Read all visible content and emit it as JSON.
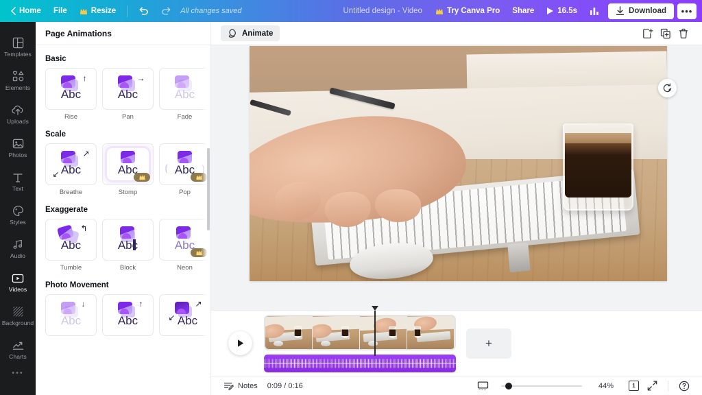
{
  "topbar": {
    "back_label": "",
    "home": "Home",
    "file": "File",
    "resize": "Resize",
    "undo_icon": "undo-icon",
    "redo_icon": "redo-icon",
    "save_status": "All changes saved",
    "design_title": "Untitled design - Video",
    "try_pro": "Try Canva Pro",
    "share": "Share",
    "duration": "16.5s",
    "insights_icon": "bar-chart-icon",
    "download": "Download",
    "more": "•••"
  },
  "sidebar": {
    "items": [
      {
        "label": "Templates",
        "icon": "templates-icon",
        "active": false
      },
      {
        "label": "Elements",
        "icon": "elements-icon",
        "active": false
      },
      {
        "label": "Uploads",
        "icon": "uploads-icon",
        "active": false
      },
      {
        "label": "Photos",
        "icon": "photos-icon",
        "active": false
      },
      {
        "label": "Text",
        "icon": "text-icon",
        "active": false
      },
      {
        "label": "Styles",
        "icon": "styles-icon",
        "active": false
      },
      {
        "label": "Audio",
        "icon": "audio-icon",
        "active": false
      },
      {
        "label": "Videos",
        "icon": "videos-icon",
        "active": true
      },
      {
        "label": "Background",
        "icon": "background-icon",
        "active": false
      },
      {
        "label": "Charts",
        "icon": "charts-icon",
        "active": false
      }
    ],
    "more": "•••"
  },
  "panel": {
    "title": "Page Animations",
    "sections": [
      {
        "title": "Basic",
        "items": [
          {
            "label": "Rise",
            "arrow": "↑",
            "pro": false,
            "faded": false
          },
          {
            "label": "Pan",
            "arrow": "→",
            "pro": false,
            "faded": false
          },
          {
            "label": "Fade",
            "arrow": "",
            "pro": false,
            "faded": true
          },
          {
            "label": "",
            "arrow": "",
            "pro": false,
            "faded": false
          }
        ]
      },
      {
        "title": "Scale",
        "items": [
          {
            "label": "Breathe",
            "arrow": "↗",
            "arrow2": "↙",
            "pro": false,
            "faded": false
          },
          {
            "label": "Stomp",
            "arrow": "",
            "pro": true,
            "faded": false,
            "halo": true
          },
          {
            "label": "Pop",
            "arrow": "",
            "pro": true,
            "faded": false
          },
          {
            "label": "",
            "arrow": "",
            "pro": false,
            "faded": false
          }
        ]
      },
      {
        "title": "Exaggerate",
        "items": [
          {
            "label": "Tumble",
            "arrow": "↰",
            "pro": false,
            "faded": false
          },
          {
            "label": "Block",
            "arrow": "",
            "pro": false,
            "faded": false
          },
          {
            "label": "Neon",
            "arrow": "",
            "pro": true,
            "faded": false
          },
          {
            "label": "",
            "arrow": "",
            "pro": false,
            "faded": false
          }
        ]
      },
      {
        "title": "Photo Movement",
        "items": [
          {
            "label": "",
            "arrow": "↓",
            "pro": false,
            "faded": true
          },
          {
            "label": "",
            "arrow": "↑",
            "pro": false,
            "faded": false
          },
          {
            "label": "",
            "arrow": "↗",
            "arrow2": "↙",
            "pro": false,
            "faded": false
          },
          {
            "label": "",
            "arrow": "",
            "pro": false,
            "faded": false
          }
        ]
      }
    ]
  },
  "editbar": {
    "animate_label": "Animate",
    "animate_icon": "animate-icon",
    "add_page_icon": "add-page-icon",
    "duplicate_page_icon": "duplicate-page-icon",
    "delete_page_icon": "trash-icon"
  },
  "canvas": {
    "magic_icon": "magic-refresh-icon",
    "description": "Photo of hands typing on a keyboard beside a glass of espresso on a wooden desk"
  },
  "timeline": {
    "play_icon": "play-icon",
    "add_page_label": "+",
    "video_track_name": "video-clip",
    "audio_track_name": "audio-clip"
  },
  "bottombar": {
    "notes_icon": "notes-icon",
    "notes": "Notes",
    "time": "0:09 / 0:16",
    "display_icon": "display-icon",
    "zoom_percent": "44%",
    "page_number": "1",
    "fullscreen_icon": "fullscreen-icon",
    "help_icon": "help-icon"
  },
  "colors": {
    "brand_start": "#00c4cc",
    "brand_end": "#8b3dff",
    "accent_purple": "#8b3dff",
    "rail_bg": "#1b1c1e",
    "audio_track": "#8a2be2"
  }
}
